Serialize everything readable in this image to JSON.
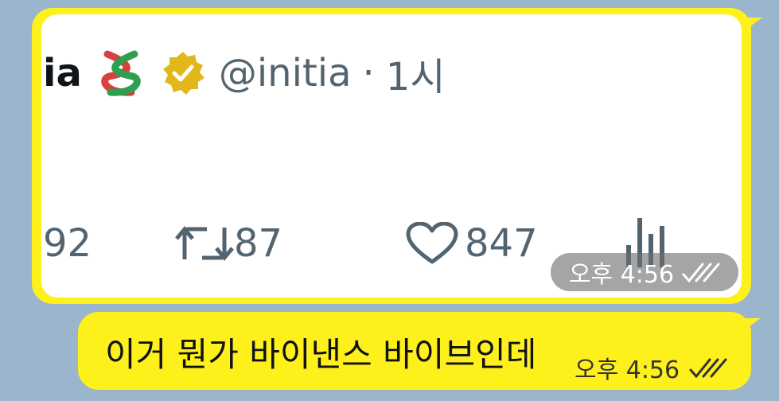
{
  "screenshot_message": {
    "tweet": {
      "name_fragment": "ia",
      "handle": "@initia",
      "separator": "·",
      "time": "1시",
      "replies": "92",
      "retweets": "87",
      "likes": "847"
    },
    "timestamp": "오후 4:56"
  },
  "text_message": {
    "text": "이거 뭔가 바이낸스 바이브인데",
    "timestamp": "오후 4:56"
  },
  "colors": {
    "bubble": "#fef01b",
    "background": "#9bb6cc",
    "tweet_gray": "#536471",
    "verified_gold": "#e2b719"
  },
  "icons": [
    "knot-logo-icon",
    "verified-badge-icon",
    "retweet-icon",
    "heart-icon",
    "views-icon",
    "double-check-icon"
  ]
}
